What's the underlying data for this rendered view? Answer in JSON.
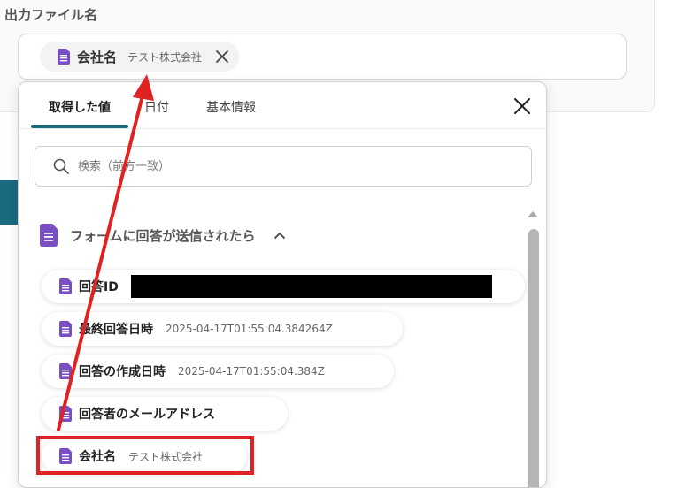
{
  "section_label": "出力ファイル名",
  "output_field": {
    "pill_name": "会社名",
    "pill_value": "テスト株式会社"
  },
  "dropdown": {
    "tabs": [
      "取得した値",
      "日付",
      "基本情報"
    ],
    "active_tab": "取得した値",
    "search_placeholder": "検索（前方一致）",
    "group_label": "フォームに回答が送信されたら",
    "items": [
      {
        "name": "回答ID",
        "value": "",
        "redacted": true
      },
      {
        "name": "最終回答日時",
        "value": "2025-04-17T01:55:04.384264Z"
      },
      {
        "name": "回答の作成日時",
        "value": "2025-04-17T01:55:04.384Z"
      },
      {
        "name": "回答者のメールアドレス",
        "value": ""
      },
      {
        "name": "会社名",
        "value": "テスト株式会社"
      }
    ]
  },
  "colors": {
    "accent": "#1a6a80",
    "doc_icon": "#7b4fc4",
    "annotation": "#e12222"
  }
}
